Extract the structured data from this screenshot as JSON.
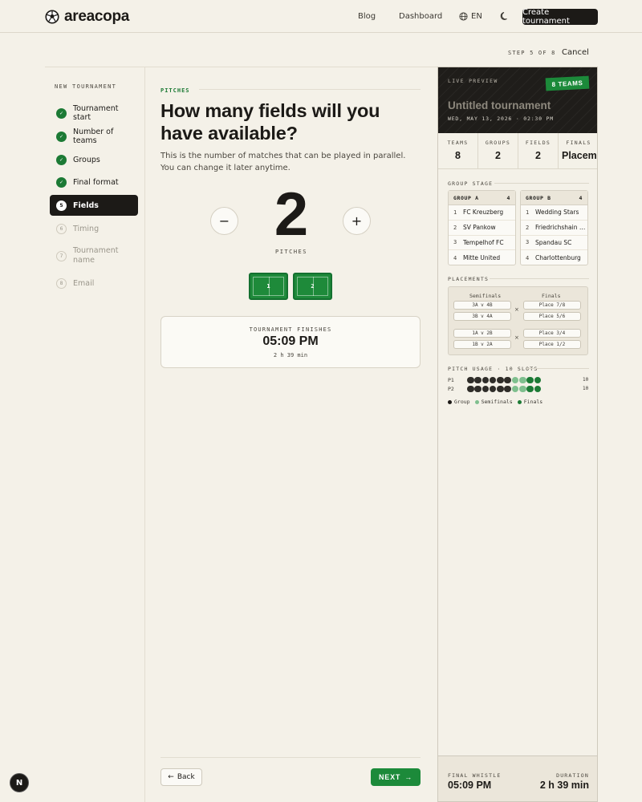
{
  "header": {
    "brand": "areacopa",
    "nav": {
      "blog": "Blog",
      "dashboard": "Dashboard",
      "language": "EN"
    },
    "cta": "Create tournament",
    "icons": {
      "logo": "soccer-ball-icon",
      "language": "globe-icon",
      "theme": "moon-icon"
    }
  },
  "wizard": {
    "step_indicator": "STEP 5 OF 8",
    "cancel_label": "Cancel"
  },
  "sidebar": {
    "title": "NEW TOURNAMENT",
    "items": [
      {
        "label": "Tournament start",
        "state": "done",
        "marker": "✓"
      },
      {
        "label": "Number of teams",
        "state": "done",
        "marker": "✓"
      },
      {
        "label": "Groups",
        "state": "done",
        "marker": "✓"
      },
      {
        "label": "Final format",
        "state": "done",
        "marker": "✓"
      },
      {
        "label": "Fields",
        "state": "active",
        "marker": "5"
      },
      {
        "label": "Timing",
        "state": "todo",
        "marker": "6"
      },
      {
        "label": "Tournament name",
        "state": "todo",
        "marker": "7"
      },
      {
        "label": "Email",
        "state": "todo",
        "marker": "8"
      }
    ]
  },
  "main": {
    "kicker": "PITCHES",
    "headline": "How many fields will you have available?",
    "subtext": "This is the number of matches that can be played in parallel. You can change it later anytime.",
    "stepper": {
      "value": "2",
      "unit_label": "PITCHES",
      "minus": "−",
      "plus": "+"
    },
    "pitches": [
      "1",
      "2"
    ],
    "finish": {
      "label": "TOURNAMENT FINISHES",
      "time": "05:09 PM",
      "duration": "2 h 39 min"
    },
    "back_label": "Back",
    "next_label": "NEXT",
    "back_arrow": "←",
    "next_arrow": "→"
  },
  "preview": {
    "live_label": "LIVE PREVIEW",
    "badge": "8 TEAMS",
    "title": "Untitled tournament",
    "date": "WED, MAY 13, 2026 · 02:30 PM",
    "stats": [
      {
        "key": "TEAMS",
        "value": "8"
      },
      {
        "key": "GROUPS",
        "value": "2"
      },
      {
        "key": "FIELDS",
        "value": "2"
      },
      {
        "key": "FINALS",
        "value": "Placem"
      }
    ],
    "group_stage_label": "GROUP STAGE",
    "groups": [
      {
        "name": "GROUP A",
        "count": "4",
        "teams": [
          "FC Kreuzberg",
          "SV Pankow",
          "Tempelhof FC",
          "Mitte United"
        ]
      },
      {
        "name": "GROUP B",
        "count": "4",
        "teams": [
          "Wedding Stars",
          "Friedrichshain …",
          "Spandau SC",
          "Charlottenburg"
        ]
      }
    ],
    "placements_label": "PLACEMENTS",
    "placements": {
      "semis_head": "Semifinals",
      "finals_head": "Finals",
      "block1": {
        "semis": [
          "3A v 4B",
          "3B v 4A"
        ],
        "finals": [
          "Place 7/8",
          "Place 5/6"
        ]
      },
      "block2": {
        "semis": [
          "1A v 2B",
          "1B v 2A"
        ],
        "finals": [
          "Place 3/4",
          "Place 1/2"
        ]
      },
      "cross": "×"
    },
    "pitch_usage_label": "PITCH USAGE · 10 SLOTS",
    "pitch_usage": [
      {
        "pitch": "P1",
        "count": "10",
        "slots": [
          "group",
          "group",
          "group",
          "group",
          "group",
          "group",
          "semi",
          "semi",
          "final",
          "final"
        ]
      },
      {
        "pitch": "P2",
        "count": "10",
        "slots": [
          "group",
          "group",
          "group",
          "group",
          "group",
          "group",
          "semi",
          "semi",
          "final",
          "final"
        ]
      }
    ],
    "legend": {
      "group": "Group",
      "semi": "Semifinals",
      "final": "Finals"
    },
    "colors": {
      "group": "#2f2d29",
      "semi": "#7fbf8e",
      "final": "#1c7a35"
    },
    "footer": {
      "final_whistle_label": "FINAL WHISTLE",
      "final_whistle_value": "05:09 PM",
      "duration_label": "DURATION",
      "duration_value": "2 h 39 min"
    }
  },
  "fab_label": "N"
}
